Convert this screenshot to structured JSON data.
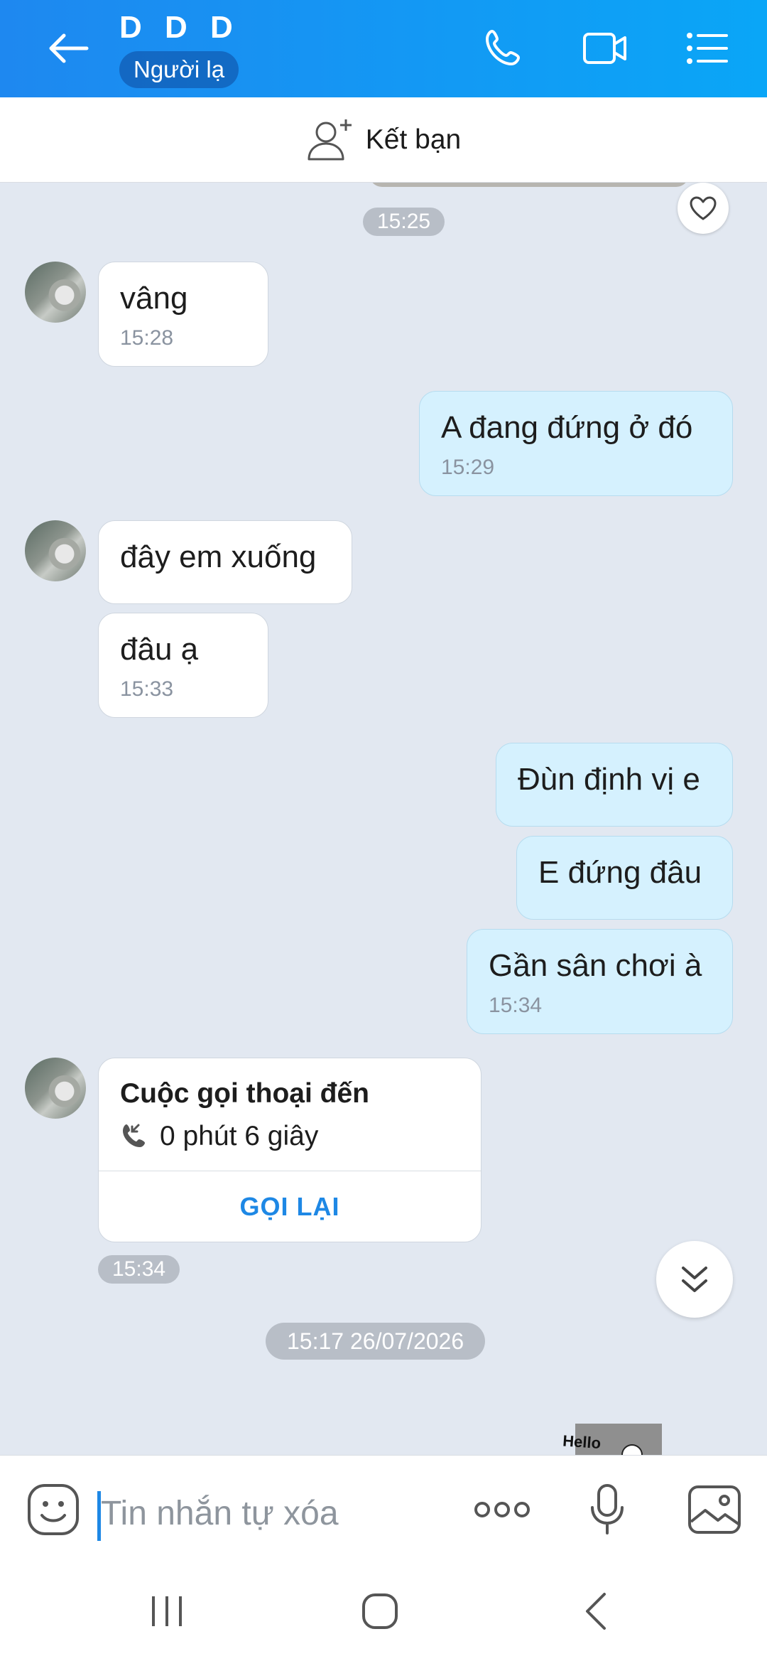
{
  "header": {
    "title": "D D D",
    "badge": "Người lạ"
  },
  "add_friend": {
    "label": "Kết bạn"
  },
  "messages": [
    {
      "type": "time",
      "text": "15:25"
    },
    {
      "type": "incoming",
      "text": "vâng",
      "time": "15:28"
    },
    {
      "type": "outgoing",
      "text": "A đang đứng ở đó",
      "time": "15:29"
    },
    {
      "type": "incoming",
      "text": "đây em xuống"
    },
    {
      "type": "incoming",
      "text": "đâu ạ",
      "time": "15:33"
    },
    {
      "type": "outgoing",
      "text": "Đùn định vị e"
    },
    {
      "type": "outgoing",
      "text": "E đứng đâu"
    },
    {
      "type": "outgoing",
      "text": "Gần sân chơi à",
      "time": "15:34"
    }
  ],
  "call_card": {
    "title": "Cuộc gọi thoại đến",
    "duration": "0 phút 6 giây",
    "action": "GỌI LẠI",
    "time": "15:34"
  },
  "date_separator": "15:17 26/07/2026",
  "sticker_text": "Hello",
  "input": {
    "placeholder": "Tin nhắn tự xóa"
  },
  "colors": {
    "header_start": "#1e88f0",
    "header_end": "#0aa6f7",
    "chat_bg": "#e2e8f1",
    "outgoing_bubble": "#d5f1fe",
    "accent": "#1e88e5"
  }
}
